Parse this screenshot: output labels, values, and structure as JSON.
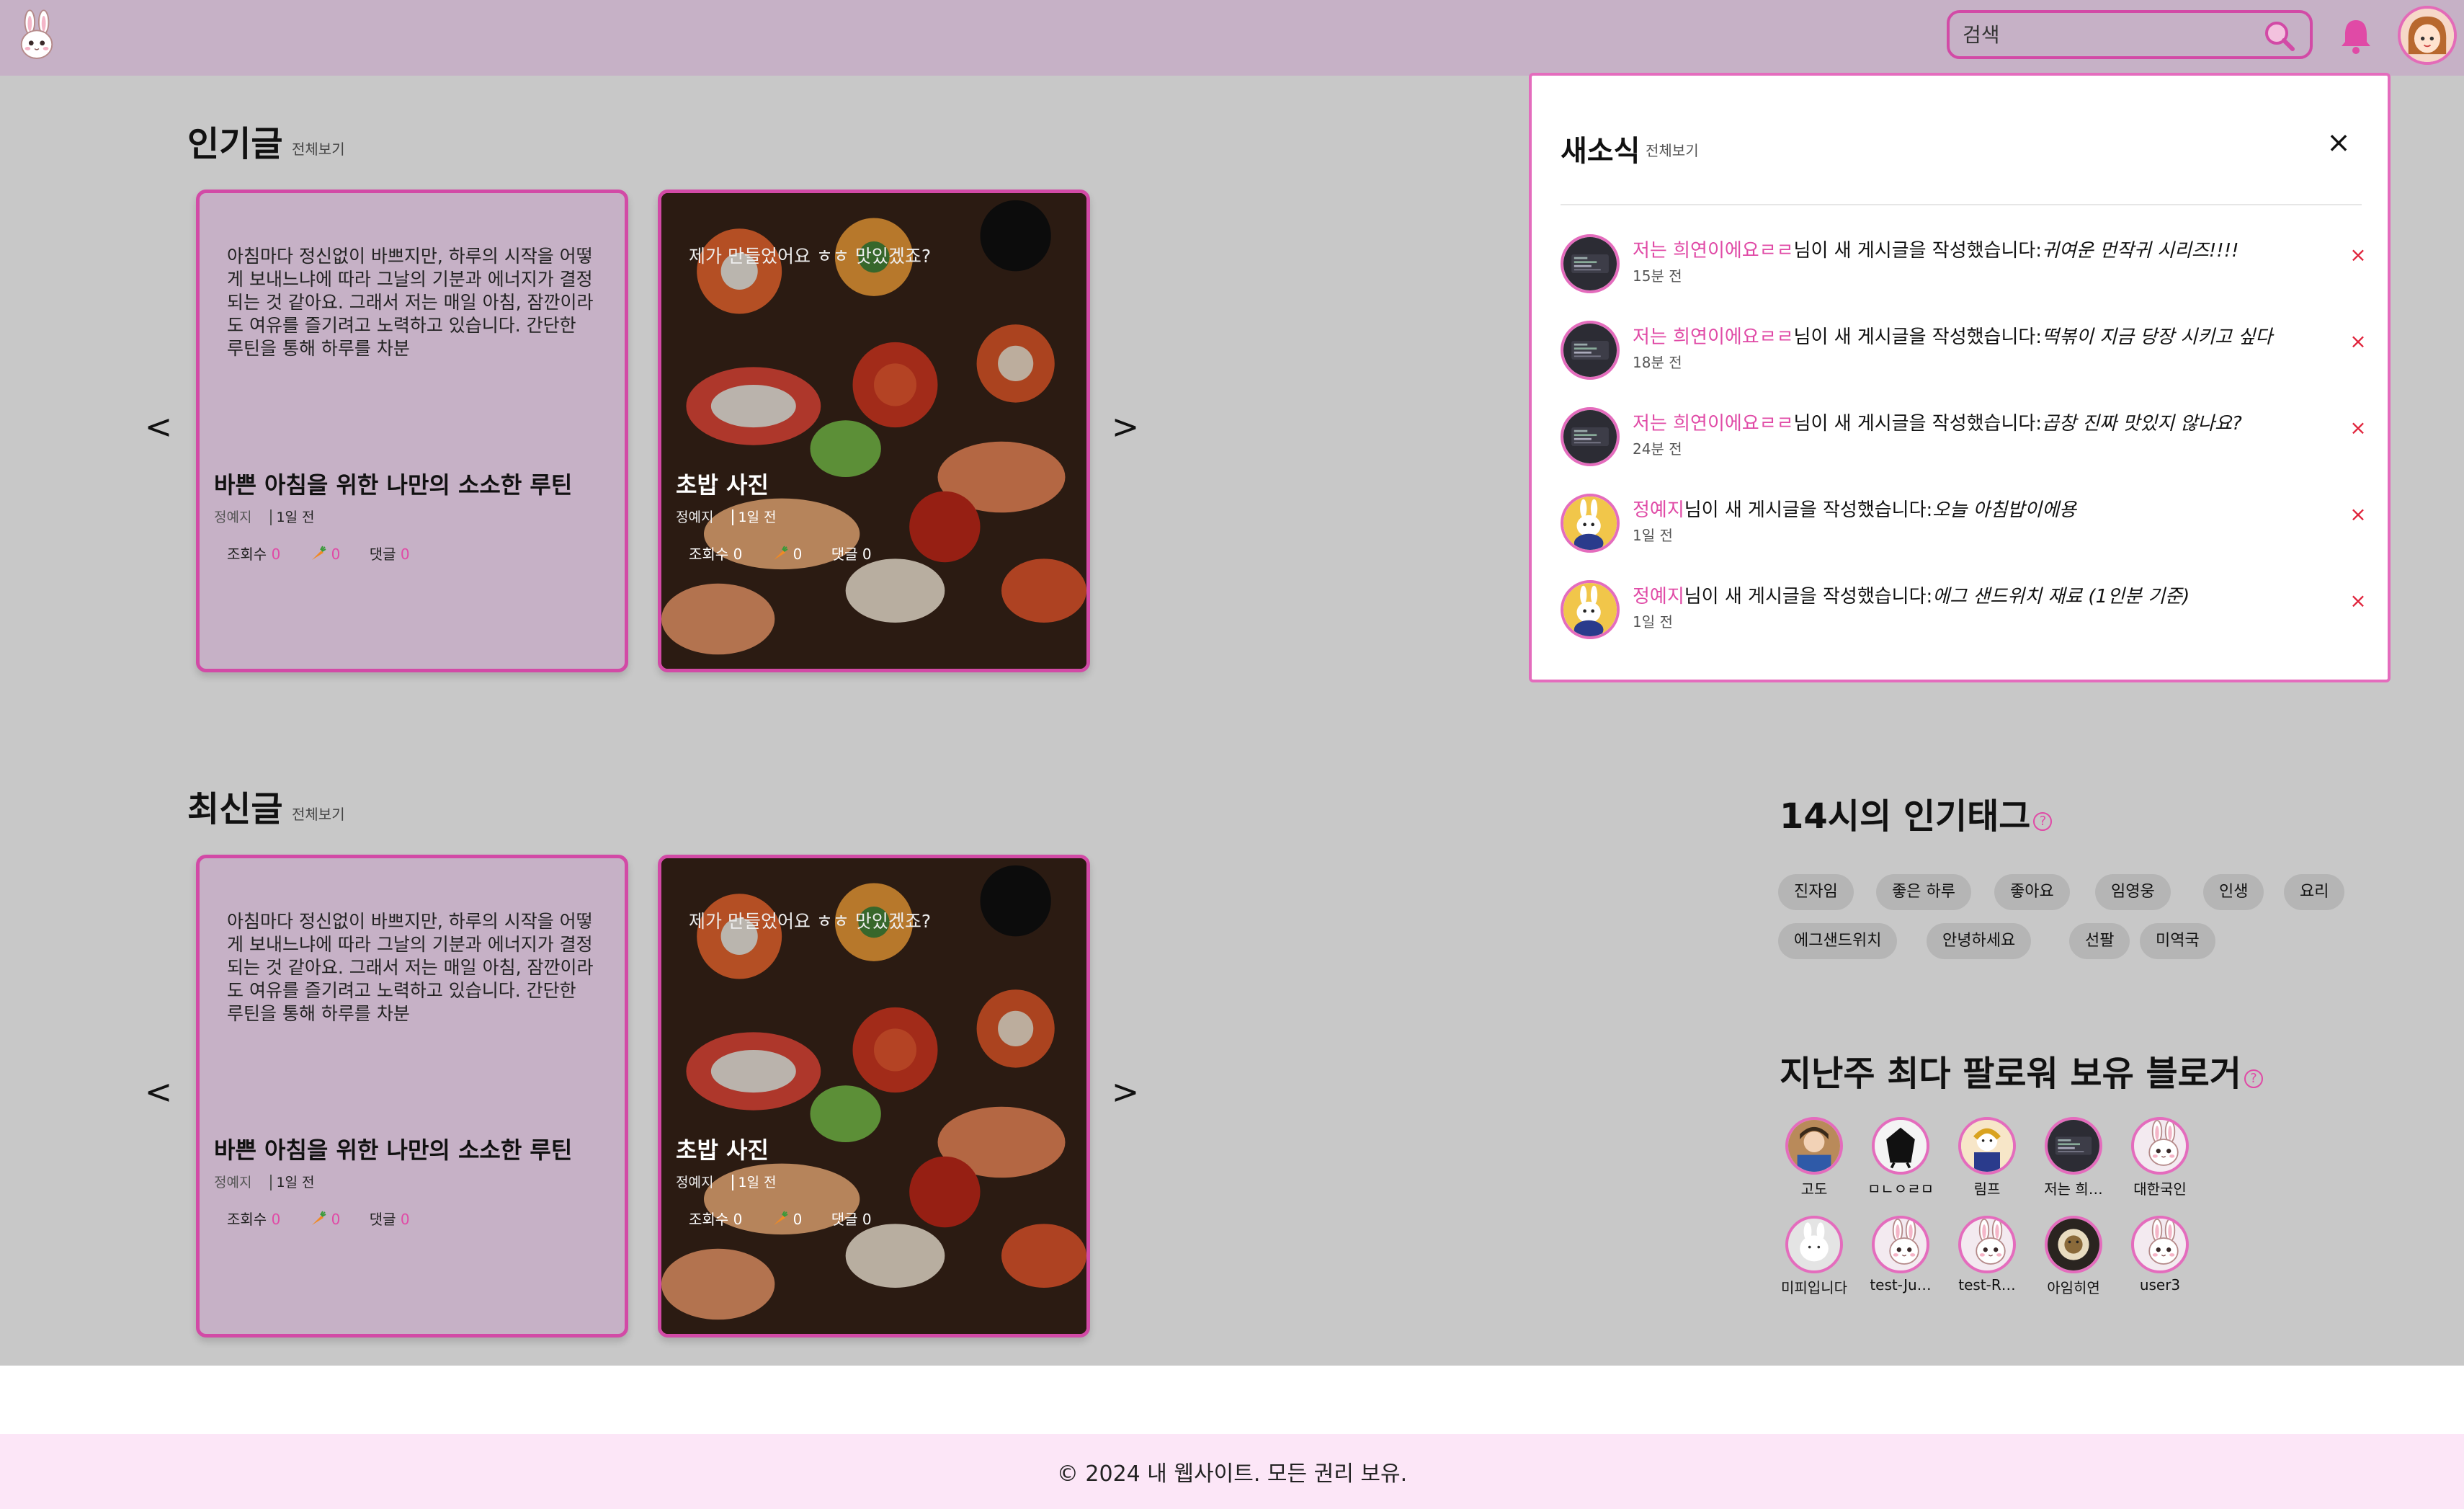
{
  "header": {
    "search_placeholder": "검색"
  },
  "popular": {
    "title": "인기글",
    "more": "전체보기",
    "prev": "<",
    "next": ">",
    "cards": [
      {
        "excerpt": "아침마다 정신없이 바쁘지만, 하루의 시작을 어떻게 보내느냐에 따라 그날의 기분과 에너지가 결정되는 것 같아요. 그래서 저는 매일 아침, 잠깐이라도 여유를 즐기려고 노력하고 있습니다. 간단한 루틴을 통해 하루를 차분",
        "title": "바쁜 아침을 위한 나만의 소소한 루틴",
        "author": "정예지",
        "time": "1일 전",
        "views_label": "조회수",
        "views": "0",
        "carrots": "0",
        "comments_label": "댓글",
        "comments": "0"
      },
      {
        "excerpt": "제가 만들었어요 ㅎㅎ 맛있겠죠?",
        "title": "초밥 사진",
        "author": "정예지",
        "time": "1일 전",
        "views_label": "조회수",
        "views": "0",
        "carrots": "0",
        "comments_label": "댓글",
        "comments": "0"
      }
    ]
  },
  "latest": {
    "title": "최신글",
    "more": "전체보기",
    "prev": "<",
    "next": ">",
    "cards": [
      {
        "excerpt": "아침마다 정신없이 바쁘지만, 하루의 시작을 어떻게 보내느냐에 따라 그날의 기분과 에너지가 결정되는 것 같아요. 그래서 저는 매일 아침, 잠깐이라도 여유를 즐기려고 노력하고 있습니다. 간단한 루틴을 통해 하루를 차분",
        "title": "바쁜 아침을 위한 나만의 소소한 루틴",
        "author": "정예지",
        "time": "1일 전",
        "views_label": "조회수",
        "views": "0",
        "carrots": "0",
        "comments_label": "댓글",
        "comments": "0"
      },
      {
        "excerpt": "제가 만들었어요 ㅎㅎ 맛있겠죠?",
        "title": "초밥 사진",
        "author": "정예지",
        "time": "1일 전",
        "views_label": "조회수",
        "views": "0",
        "carrots": "0",
        "comments_label": "댓글",
        "comments": "0"
      }
    ]
  },
  "notifications": {
    "title": "새소식",
    "more": "전체보기",
    "close": "×",
    "delete": "×",
    "action": "님이 새 게시글을 작성했습니다:",
    "items": [
      {
        "user": "저는 희연이에요ㄹㄹ",
        "post": "귀여운 먼작귀 시리즈!!!!",
        "time": "15분 전",
        "avatar": "dark"
      },
      {
        "user": "저는 희연이에요ㄹㄹ",
        "post": "떡볶이 지금 당장 시키고 싶다",
        "time": "18분 전",
        "avatar": "dark"
      },
      {
        "user": "저는 희연이에요ㄹㄹ",
        "post": "곱창 진짜 맛있지 않나요?",
        "time": "24분 전",
        "avatar": "dark"
      },
      {
        "user": "정예지",
        "post": "오늘 아침밥이에용",
        "time": "1일 전",
        "avatar": "bunny"
      },
      {
        "user": "정예지",
        "post": "에그 샌드위치 재료 (1인분 기준)",
        "time": "1일 전",
        "avatar": "bunny"
      }
    ]
  },
  "tags": {
    "title": "14시의 인기태그",
    "help": "?",
    "items": [
      "진자임",
      "좋은 하루",
      "좋아요",
      "임영웅",
      "인생",
      "요리",
      "에그샌드위치",
      "안녕하세요",
      "선팔",
      "미역국"
    ]
  },
  "bloggers": {
    "title": "지난주 최다 팔로워 보유 블로거",
    "help": "?",
    "items": [
      "고도",
      "ㅁㄴㅇㄹㅁ",
      "림프",
      "저는 희…",
      "대한국인",
      "미피입니다",
      "test-Ju…",
      "test-R…",
      "아임히연",
      "user3"
    ]
  },
  "footer": {
    "text": "© 2024 내 웹사이트. 모든 권리 보유."
  },
  "colors": {
    "accent": "#e04aa6",
    "header_bg": "#c6b1c6",
    "overlay_bg": "#c8c8c8",
    "footer_bg": "#fce6f7",
    "delete": "#e0223a"
  }
}
